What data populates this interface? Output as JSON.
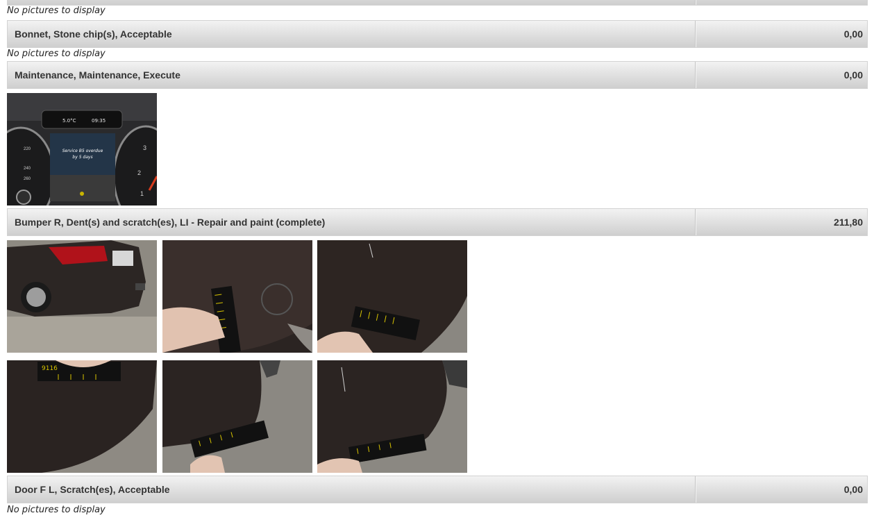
{
  "sections": [
    {
      "title": "Bonnet, Stone chip(s), Acceptable",
      "amount": "0,00"
    },
    {
      "title": "Maintenance, Maintenance, Execute",
      "amount": "0,00"
    },
    {
      "title": "Bumper R, Dent(s) and scratch(es), LI - Repair and paint (complete)",
      "amount": "211,80"
    },
    {
      "title": "Door F L, Scratch(es), Acceptable",
      "amount": "0,00"
    }
  ],
  "notes": {
    "no_pictures": "No pictures to display"
  },
  "dashboard_photo": {
    "temperature": "5.0°C",
    "clock": "09:35",
    "message_line1": "Service B5 overdue",
    "message_line2": "by 5 days"
  },
  "ruler_text": "9116"
}
